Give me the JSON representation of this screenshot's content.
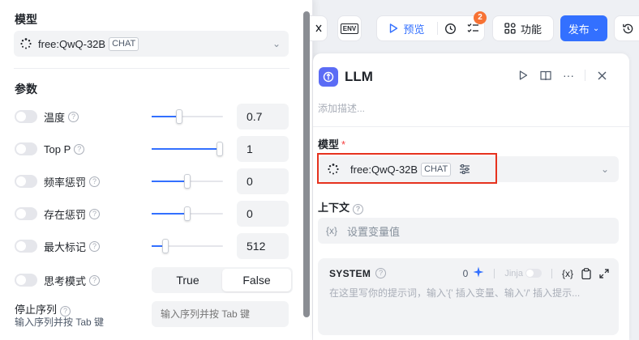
{
  "left_panel": {
    "model_section_title": "模型",
    "model": {
      "name": "free:QwQ-32B",
      "badge": "CHAT"
    },
    "params_title": "参数",
    "params": [
      {
        "label": "温度",
        "value": "0.7",
        "fraction": 0.37
      },
      {
        "label": "Top P",
        "value": "1",
        "fraction": 1.0
      },
      {
        "label": "频率惩罚",
        "value": "0",
        "fraction": 0.5
      },
      {
        "label": "存在惩罚",
        "value": "0",
        "fraction": 0.5
      },
      {
        "label": "最大标记",
        "value": "512",
        "fraction": 0.16
      }
    ],
    "think_mode": {
      "label": "思考模式",
      "options": [
        "True",
        "False"
      ],
      "selected": "False"
    },
    "stop_sequence": {
      "label": "停止序列",
      "hint": "输入序列并按 Tab 键",
      "placeholder": "输入序列并按 Tab 键"
    }
  },
  "toolbar": {
    "env_label": "ENV",
    "preview_label": "预览",
    "checklist_count": "2",
    "features_label": "功能",
    "publish_label": "发布"
  },
  "node": {
    "title": "LLM",
    "desc_placeholder": "添加描述...",
    "model_label": "模型",
    "required_mark": "*",
    "model": {
      "name": "free:QwQ-32B",
      "badge": "CHAT"
    },
    "context_label": "上下文",
    "context_icon": "{x}",
    "context_placeholder": "设置变量值",
    "system": {
      "title": "SYSTEM",
      "token_count": "0",
      "jinja_label": "Jinja",
      "var_icon": "{x}",
      "placeholder": "在这里写你的提示词，输入'{' 插入变量、输入'/' 插入提示..."
    }
  },
  "colors": {
    "accent": "#3370ff",
    "highlight": "#e6321e",
    "badge": "#f77234",
    "node_icon": "#5b6cf5"
  }
}
